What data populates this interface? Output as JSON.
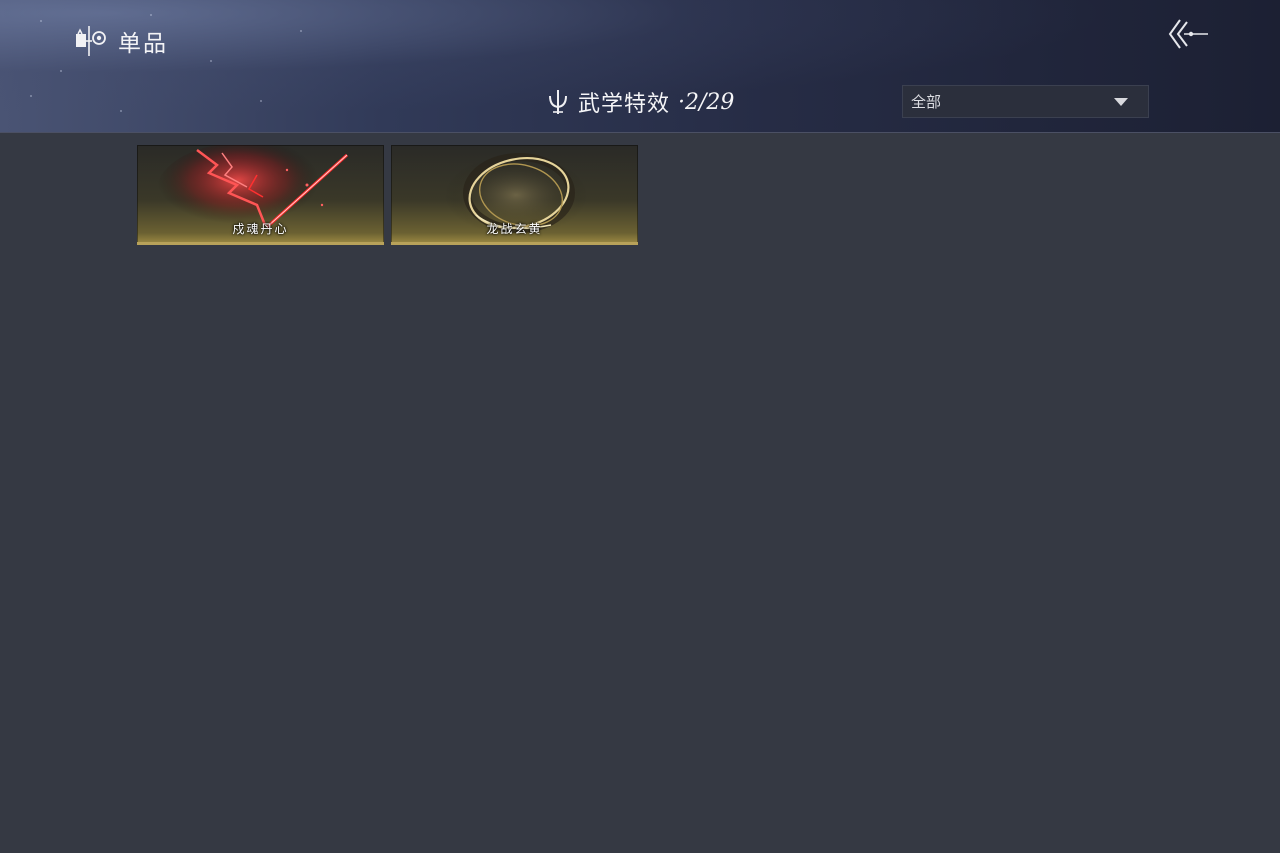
{
  "header": {
    "title": "单品",
    "title_icon": "wardrobe-icon",
    "back_icon": "back-arrow-icon"
  },
  "section": {
    "title": "武学特效",
    "count": "·2/29",
    "icon": "trident-icon"
  },
  "filter": {
    "selected": "全部",
    "icon": "caret-down-icon"
  },
  "items": [
    {
      "label": "戍魂丹心",
      "art": "red-lightning-spear-effect",
      "accent": "#e0242a"
    },
    {
      "label": "龙战玄黄",
      "art": "golden-ring-effect",
      "accent": "#d8c27a"
    }
  ],
  "colors": {
    "background": "#353943",
    "header_dark": "#1c2033",
    "card_gold": "#b8a25a"
  }
}
